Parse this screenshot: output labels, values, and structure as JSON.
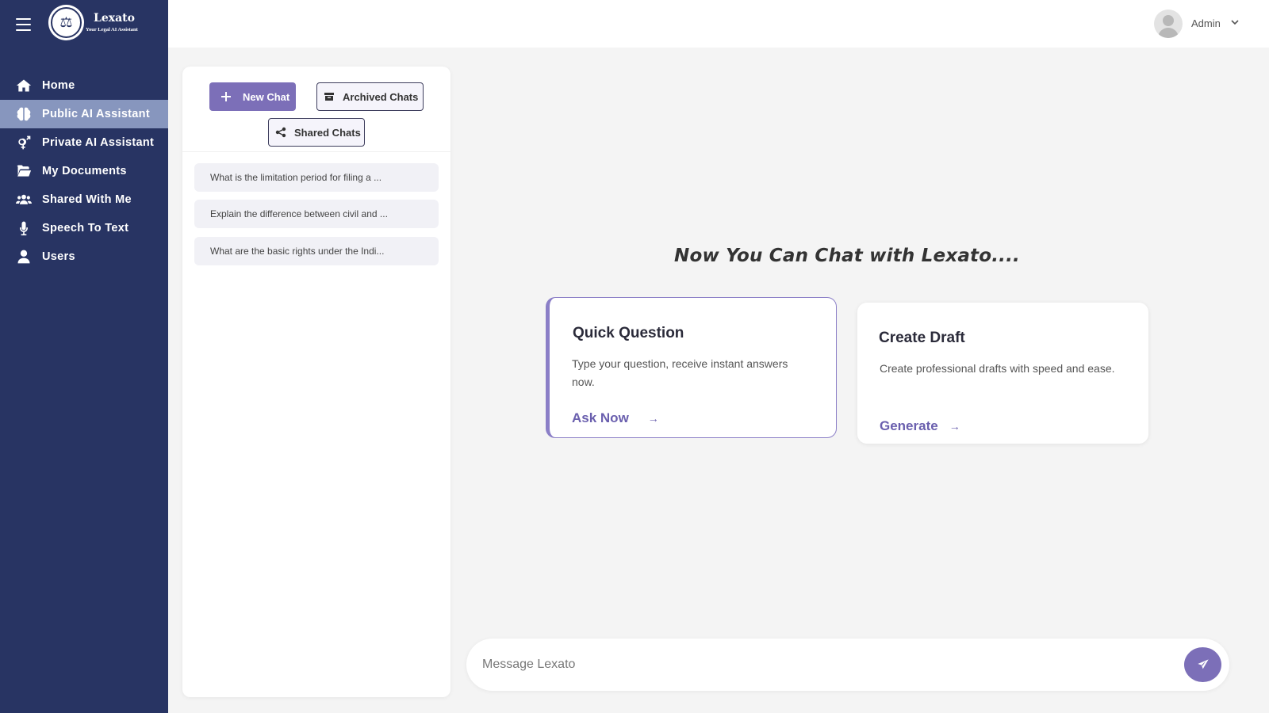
{
  "brand": {
    "name": "Lexato",
    "tagline": "Your Legal AI Assistant"
  },
  "sidebar": {
    "items": [
      {
        "label": "Home",
        "icon": "home-icon",
        "active": false
      },
      {
        "label": "Public AI Assistant",
        "icon": "brain-icon",
        "active": true
      },
      {
        "label": "Private AI Assistant",
        "icon": "gender-icon",
        "active": false
      },
      {
        "label": "My Documents",
        "icon": "folder-open-icon",
        "active": false
      },
      {
        "label": "Shared With Me",
        "icon": "users-icon",
        "active": false
      },
      {
        "label": "Speech To Text",
        "icon": "microphone-icon",
        "active": false
      },
      {
        "label": "Users",
        "icon": "user-icon",
        "active": false
      }
    ]
  },
  "header": {
    "user_name": "Admin"
  },
  "chat_panel": {
    "new_chat_label": "New Chat",
    "archived_label": "Archived Chats",
    "shared_label": "Shared Chats",
    "history": [
      "What is the limitation period for filing a ...",
      "Explain the difference between civil and ...",
      "What are the basic rights under the Indi..."
    ]
  },
  "main": {
    "headline": "Now You Can Chat with Lexato....",
    "cards": [
      {
        "title": "Quick Question",
        "description": "Type your question, receive instant answers now.",
        "link": "Ask Now",
        "arrow": "→"
      },
      {
        "title": "Create Draft",
        "description": "Create professional drafts with speed and ease.",
        "link": "Generate",
        "arrow": "→"
      }
    ]
  },
  "composer": {
    "placeholder": "Message Lexato"
  },
  "colors": {
    "sidebar": "#283463",
    "sidebar_active": "#8796be",
    "accent": "#7c6fb8",
    "background": "#f4f4f4"
  }
}
